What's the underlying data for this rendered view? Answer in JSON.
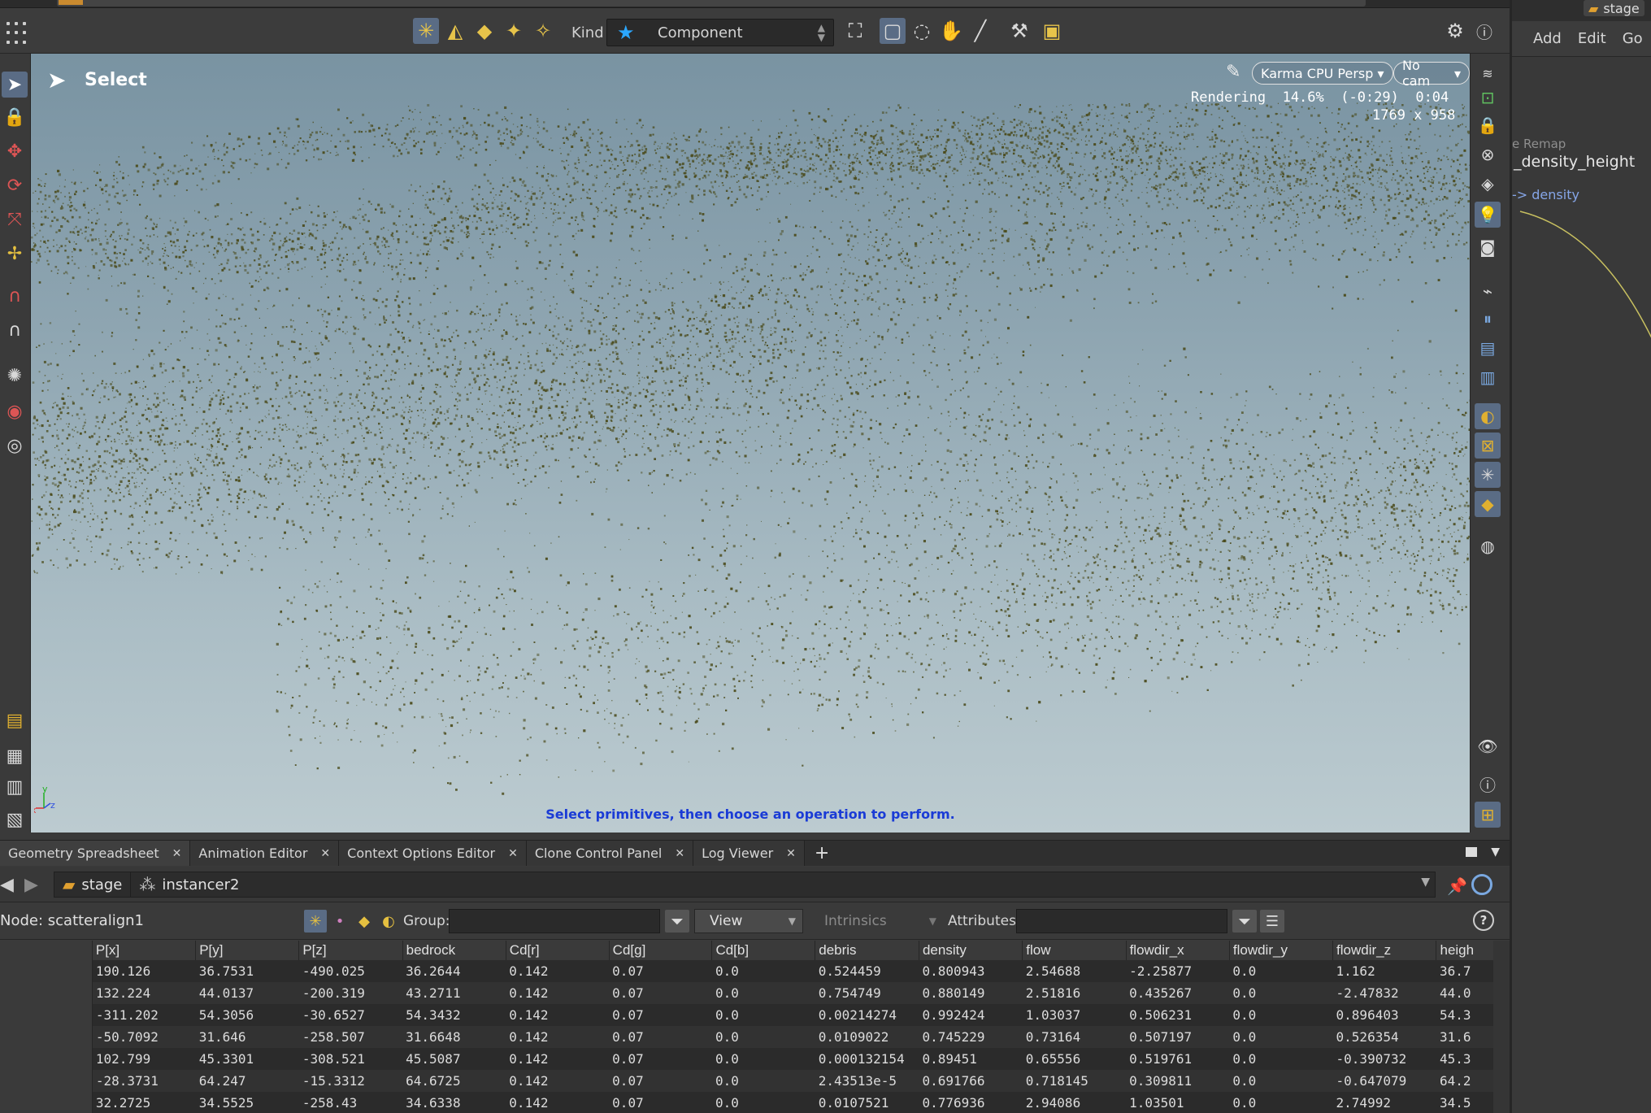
{
  "toolbar": {
    "kind_label": "Kind",
    "kind_value": "Component"
  },
  "viewport": {
    "mode_label": "Select",
    "renderer": "Karma CPU  Persp",
    "camera": "No cam",
    "render_status": "Rendering  14.6%  (-0:29)  0:04",
    "resolution": "1769 x 958",
    "hint": "Select primitives, then choose an operation to perform.",
    "axis_x": "x",
    "axis_y": "y",
    "axis_z": "z"
  },
  "network": {
    "stage_label": "stage",
    "menu": [
      "Add",
      "Edit",
      "Go"
    ],
    "remap_label": "e Remap",
    "node_label": "_density_height",
    "link_label": "-> density"
  },
  "tabs": [
    {
      "label": "Geometry Spreadsheet"
    },
    {
      "label": "Animation Editor"
    },
    {
      "label": "Context Options Editor"
    },
    {
      "label": "Clone Control Panel"
    },
    {
      "label": "Log Viewer"
    }
  ],
  "path": {
    "root": "stage",
    "node": "instancer2"
  },
  "sheet_header": {
    "node_label": "Node: scatteralign1",
    "group_label": "Group:",
    "view_label": "View",
    "intrinsics_label": "Intrinsics",
    "attributes_label": "Attributes:"
  },
  "table": {
    "columns": [
      "P[x]",
      "P[y]",
      "P[z]",
      "bedrock",
      "Cd[r]",
      "Cd[g]",
      "Cd[b]",
      "debris",
      "density",
      "flow",
      "flowdir_x",
      "flowdir_y",
      "flowdir_z",
      "heigh"
    ],
    "rows": [
      [
        "190.126",
        "36.7531",
        "-490.025",
        "36.2644",
        "0.142",
        "0.07",
        "0.0",
        "0.524459",
        "0.800943",
        "2.54688",
        "-2.25877",
        "0.0",
        "1.162",
        "36.7"
      ],
      [
        "132.224",
        "44.0137",
        "-200.319",
        "43.2711",
        "0.142",
        "0.07",
        "0.0",
        "0.754749",
        "0.880149",
        "2.51816",
        "0.435267",
        "0.0",
        "-2.47832",
        "44.0"
      ],
      [
        "-311.202",
        "54.3056",
        "-30.6527",
        "54.3432",
        "0.142",
        "0.07",
        "0.0",
        "0.00214274",
        "0.992424",
        "1.03037",
        "0.506231",
        "0.0",
        "0.896403",
        "54.3"
      ],
      [
        "-50.7092",
        "31.646",
        "-258.507",
        "31.6648",
        "0.142",
        "0.07",
        "0.0",
        "0.0109022",
        "0.745229",
        "0.73164",
        "0.507197",
        "0.0",
        "0.526354",
        "31.6"
      ],
      [
        "102.799",
        "45.3301",
        "-308.521",
        "45.5087",
        "0.142",
        "0.07",
        "0.0",
        "0.000132154",
        "0.89451",
        "0.65556",
        "0.519761",
        "0.0",
        "-0.390732",
        "45.3"
      ],
      [
        "-28.3731",
        "64.247",
        "-15.3312",
        "64.6725",
        "0.142",
        "0.07",
        "0.0",
        "2.43513e-5",
        "0.691766",
        "0.718145",
        "0.309811",
        "0.0",
        "-0.647079",
        "64.2"
      ],
      [
        "32.2725",
        "34.5525",
        "-258.43",
        "34.6338",
        "0.142",
        "0.07",
        "0.0",
        "0.0107521",
        "0.776936",
        "2.94086",
        "1.03501",
        "0.0",
        "2.74992",
        "34.5"
      ]
    ]
  },
  "colors": {
    "accent": "#5a6c85",
    "hint_blue": "#1a3bd6",
    "scatter": "#4a4a1a",
    "sky_top": "#7993a2",
    "sky_bottom": "#bccbd0"
  }
}
